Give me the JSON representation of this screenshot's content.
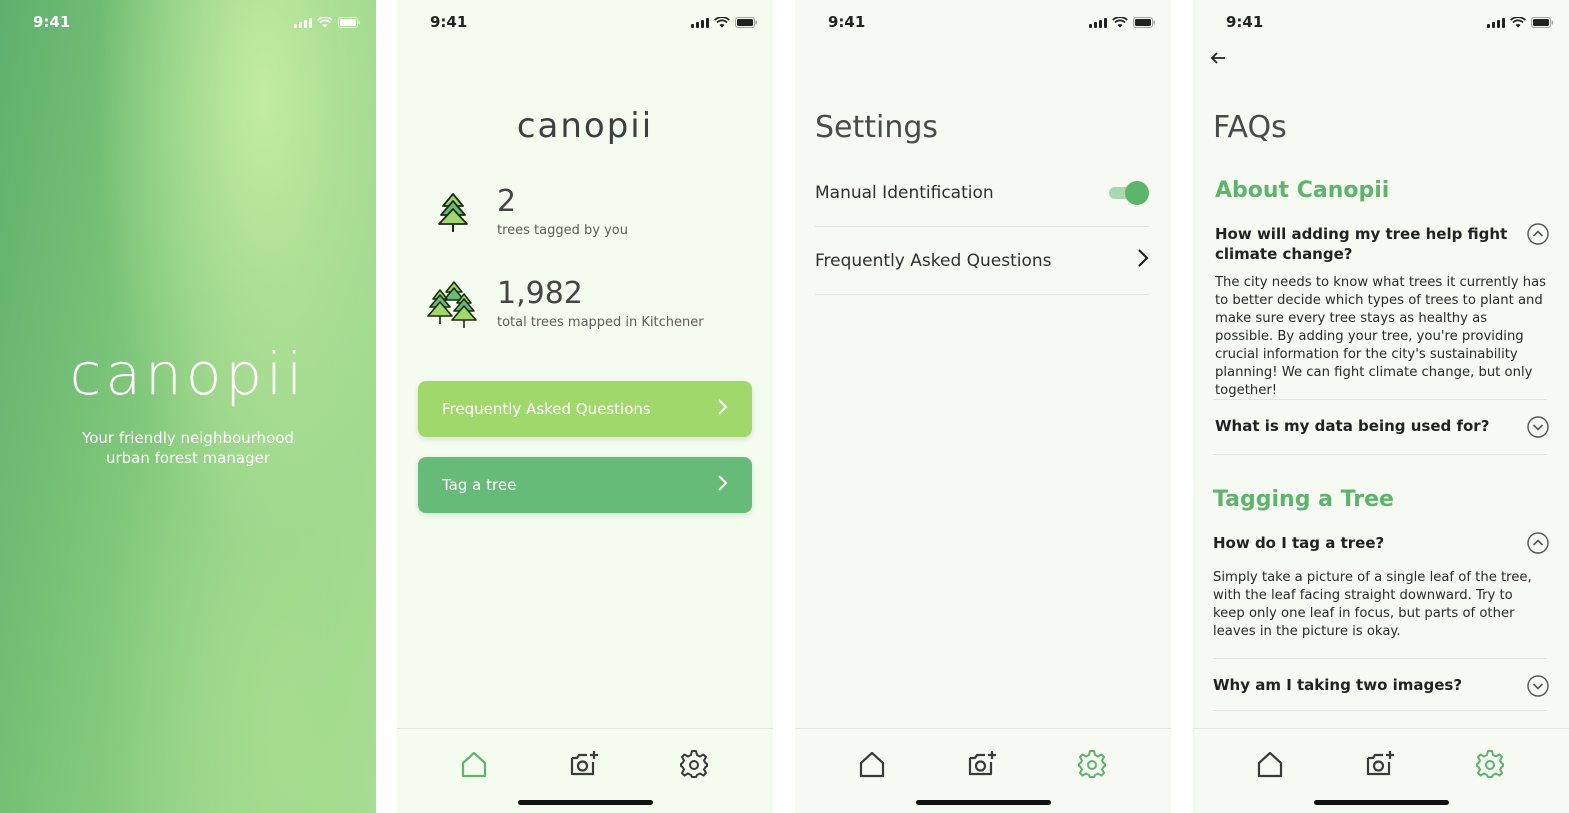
{
  "status_bar": {
    "time": "9:41"
  },
  "splash": {
    "logo": "canopii",
    "tagline_line1": "Your friendly neighbourhood",
    "tagline_line2": "urban forest manager"
  },
  "home": {
    "logo": "canopii",
    "stats": [
      {
        "value": "2",
        "label": "trees tagged by you"
      },
      {
        "value": "1,982",
        "label": "total trees mapped in Kitchener"
      }
    ],
    "buttons": {
      "faq": "Frequently Asked Questions",
      "tag": "Tag a tree"
    }
  },
  "settings": {
    "title": "Settings",
    "rows": [
      {
        "label": "Manual Identification"
      },
      {
        "label": "Frequently Asked Questions"
      }
    ],
    "manual_identification_on": true
  },
  "faq": {
    "title": "FAQs",
    "sections": [
      {
        "title": "About Canopii",
        "items": [
          {
            "question": "How will adding my tree help fight climate change?",
            "answer": "The city needs to know what trees it currently has to better decide which types of trees to plant and make sure every tree stays as healthy as possible. By adding your tree, you're providing crucial information for the city's sustainability planning! We can fight climate change, but only together!"
          },
          {
            "question": "What is my data being used for?"
          }
        ]
      },
      {
        "title": "Tagging a Tree",
        "items": [
          {
            "question": "How do I tag a tree?",
            "answer": "Simply take a picture of a single leaf of the tree, with the leaf facing straight downward. Try to keep only one leaf in focus, but parts of other leaves in the picture is okay."
          },
          {
            "question": "Why am I taking two images?"
          }
        ]
      }
    ]
  },
  "colors": {
    "accent": "#5db56b",
    "faq_button": "#a1d86b",
    "tag_button": "#67bb78"
  }
}
